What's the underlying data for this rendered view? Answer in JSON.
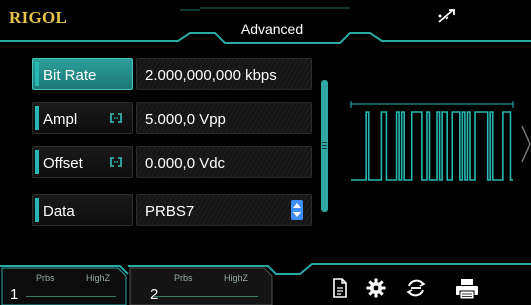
{
  "header": {
    "brand": "RIGOL",
    "mode_title": "Advanced",
    "usb_icon": "usb-icon"
  },
  "params": [
    {
      "label": "Bit Rate",
      "value": "2.000,000,000 kbps",
      "active": true,
      "linked": false,
      "spinner": false
    },
    {
      "label": "Ampl",
      "value": "5.000,0 Vpp",
      "active": false,
      "linked": true,
      "spinner": false
    },
    {
      "label": "Offset",
      "value": "0.000,0 Vdc",
      "active": false,
      "linked": true,
      "spinner": false
    },
    {
      "label": "Data",
      "value": "PRBS7",
      "active": false,
      "linked": false,
      "spinner": true
    }
  ],
  "channels": [
    {
      "number": "1",
      "mode": "Prbs",
      "load": "HighZ",
      "active": true
    },
    {
      "number": "2",
      "mode": "Prbs",
      "load": "HighZ",
      "active": false
    }
  ],
  "toolbar_icons": [
    "document-icon",
    "settings-gear-icon",
    "sync-icon",
    "print-icon"
  ],
  "colors": {
    "accent": "#27b8b3",
    "brand": "#e8c44a",
    "spinner": "#3f8dff",
    "background": "#000000"
  }
}
